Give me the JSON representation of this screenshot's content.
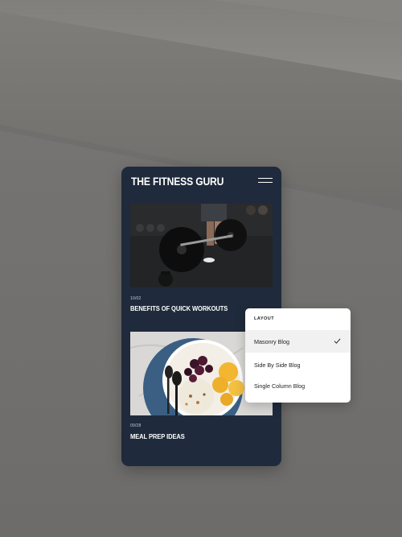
{
  "app": {
    "title": "THE FITNESS GURU",
    "menu_icon": "hamburger-menu-icon"
  },
  "posts": [
    {
      "date": "10/02",
      "title": "BENEFITS OF QUICK WORKOUTS",
      "image": "barbell-deadlift-photo"
    },
    {
      "date": "09/28",
      "title": "MEAL PREP IDEAS",
      "image": "fruit-yogurt-bowl-photo"
    }
  ],
  "layout_menu": {
    "header": "LAYOUT",
    "options": [
      {
        "label": "Masonry Blog",
        "selected": true
      },
      {
        "label": "Side By Side Blog",
        "selected": false
      },
      {
        "label": "Single Column Blog",
        "selected": false
      }
    ],
    "check_icon": "checkmark-icon"
  },
  "colors": {
    "phone_background": "#1f2b3c",
    "dropdown_background": "#ffffff",
    "selected_row": "#f1f1f1",
    "concrete": "#8a8a87"
  }
}
